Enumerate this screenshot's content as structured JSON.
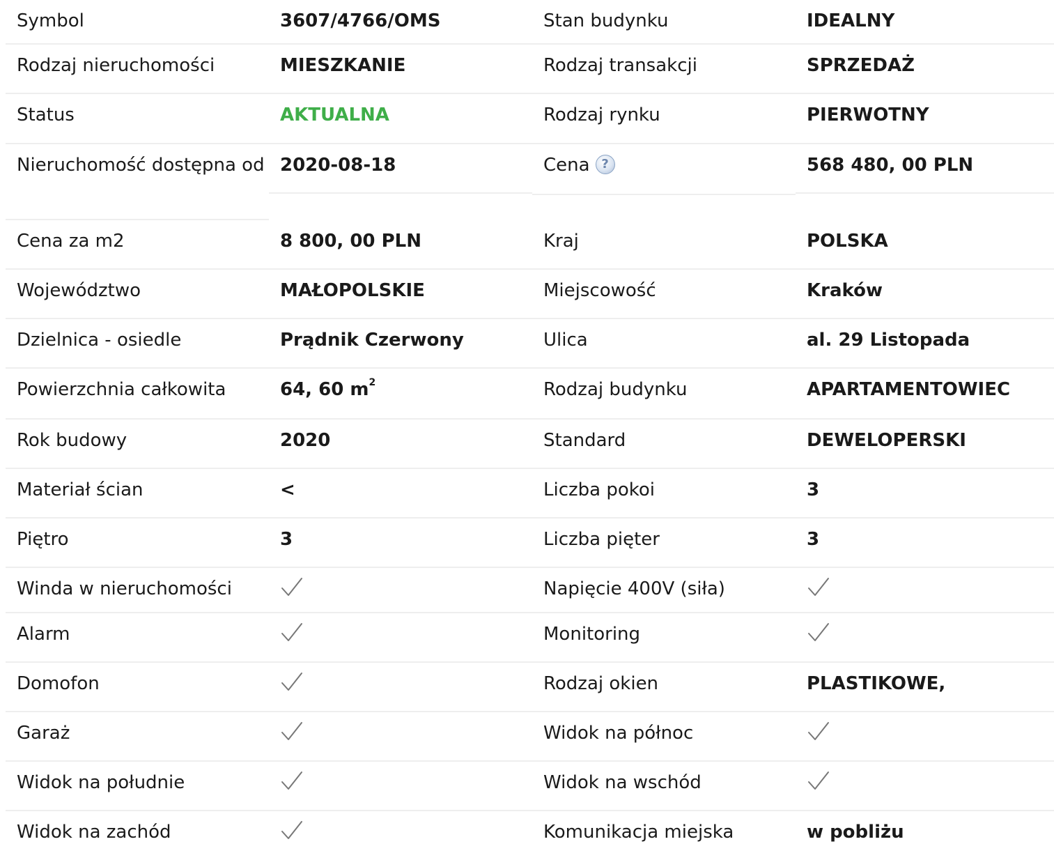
{
  "rows": [
    {
      "label_left": "Symbol",
      "value_left": "3607/4766/OMS",
      "label_right": "Stan budynku",
      "value_right": "IDEALNY"
    },
    {
      "label_left": "Rodzaj nieruchomości",
      "value_left": "MIESZKANIE",
      "label_right": "Rodzaj transakcji",
      "value_right": "SPRZEDAŻ"
    },
    {
      "label_left": "Status",
      "value_left": "AKTUALNA",
      "label_right": "Rodzaj rynku",
      "value_right": "PIERWOTNY"
    },
    {
      "label_left": "Nieruchomość dostępna od",
      "value_left": "2020-08-18",
      "label_right": "Cena",
      "value_right": "568 480, 00 PLN"
    },
    {
      "label_left": "Cena za m2",
      "value_left": "8 800, 00 PLN",
      "label_right": "Kraj",
      "value_right": "POLSKA"
    },
    {
      "label_left": "Województwo",
      "value_left": "MAŁOPOLSKIE",
      "label_right": "Miejscowość",
      "value_right": "Kraków"
    },
    {
      "label_left": "Dzielnica - osiedle",
      "value_left": "Prądnik Czerwony",
      "label_right": "Ulica",
      "value_right": "al. 29 Listopada"
    },
    {
      "label_left": "Powierzchnia całkowita",
      "value_left": "64, 60 m",
      "value_left_sup": "2",
      "label_right": "Rodzaj budynku",
      "value_right": "APARTAMENTOWIEC"
    },
    {
      "label_left": "Rok budowy",
      "value_left": "2020",
      "label_right": "Standard",
      "value_right": "DEWELOPERSKI"
    },
    {
      "label_left": "Materiał ścian",
      "value_left": "<",
      "label_right": "Liczba pokoi",
      "value_right": "3"
    },
    {
      "label_left": "Piętro",
      "value_left": "3",
      "label_right": "Liczba pięter",
      "value_right": "3"
    },
    {
      "label_left": "Winda w nieruchomości",
      "value_left": "check",
      "label_right": "Napięcie 400V (siła)",
      "value_right": "check"
    },
    {
      "label_left": "Alarm",
      "value_left": "check",
      "label_right": "Monitoring",
      "value_right": "check"
    },
    {
      "label_left": "Domofon",
      "value_left": "check",
      "label_right": "Rodzaj okien",
      "value_right": "PLASTIKOWE,"
    },
    {
      "label_left": "Garaż",
      "value_left": "check",
      "label_right": "Widok na północ",
      "value_right": "check"
    },
    {
      "label_left": "Widok na południe",
      "value_left": "check",
      "label_right": "Widok na wschód",
      "value_right": "check"
    },
    {
      "label_left": "Widok na zachód",
      "value_left": "check",
      "label_right": "Komunikacja miejska",
      "value_right": "w pobliżu"
    }
  ],
  "icons": {
    "check": "checkmark-icon",
    "help": "help-question-icon"
  },
  "help_glyph": "?",
  "colors": {
    "status_active": "#3fae49",
    "divider": "#eeeeee",
    "check": "#777777"
  }
}
